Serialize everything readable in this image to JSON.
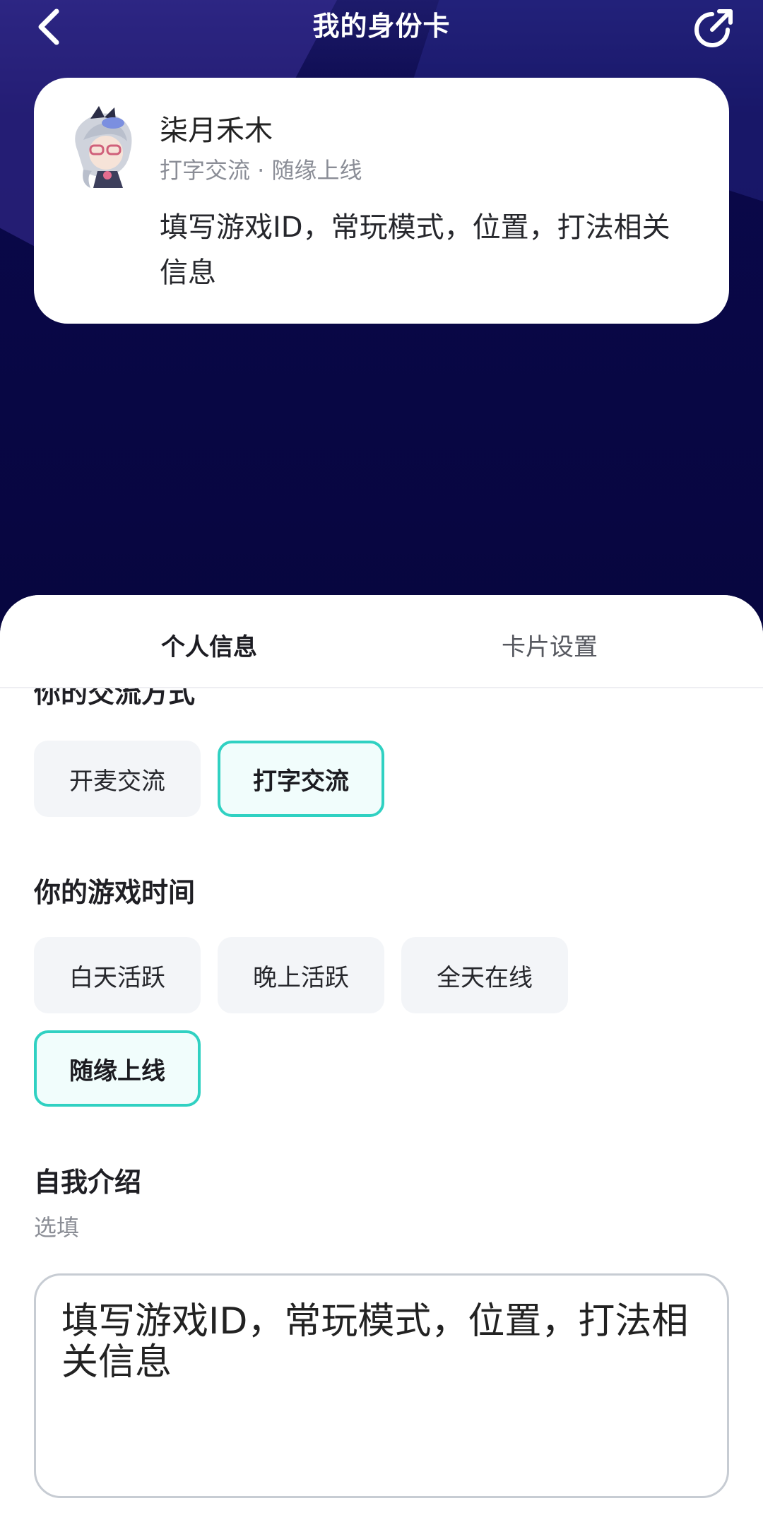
{
  "header": {
    "title": "我的身份卡"
  },
  "card": {
    "name": "柒月禾木",
    "meta": "打字交流 · 随缘上线",
    "intro": "填写游戏ID，常玩模式，位置，打法相关信息"
  },
  "tabs": [
    {
      "label": "个人信息",
      "active": true
    },
    {
      "label": "卡片设置",
      "active": false
    }
  ],
  "comm_section": {
    "title": "你的交流方式",
    "options": [
      {
        "label": "开麦交流",
        "selected": false
      },
      {
        "label": "打字交流",
        "selected": true
      }
    ]
  },
  "time_section": {
    "title": "你的游戏时间",
    "options": [
      {
        "label": "白天活跃",
        "selected": false
      },
      {
        "label": "晚上活跃",
        "selected": false
      },
      {
        "label": "全天在线",
        "selected": false
      },
      {
        "label": "随缘上线",
        "selected": true
      }
    ]
  },
  "intro_section": {
    "title": "自我介绍",
    "hint": "选填",
    "value": "填写游戏ID，常玩模式，位置，打法相关信息"
  },
  "colors": {
    "accent": "#30d1c2",
    "header_bg": "#0a084a"
  }
}
